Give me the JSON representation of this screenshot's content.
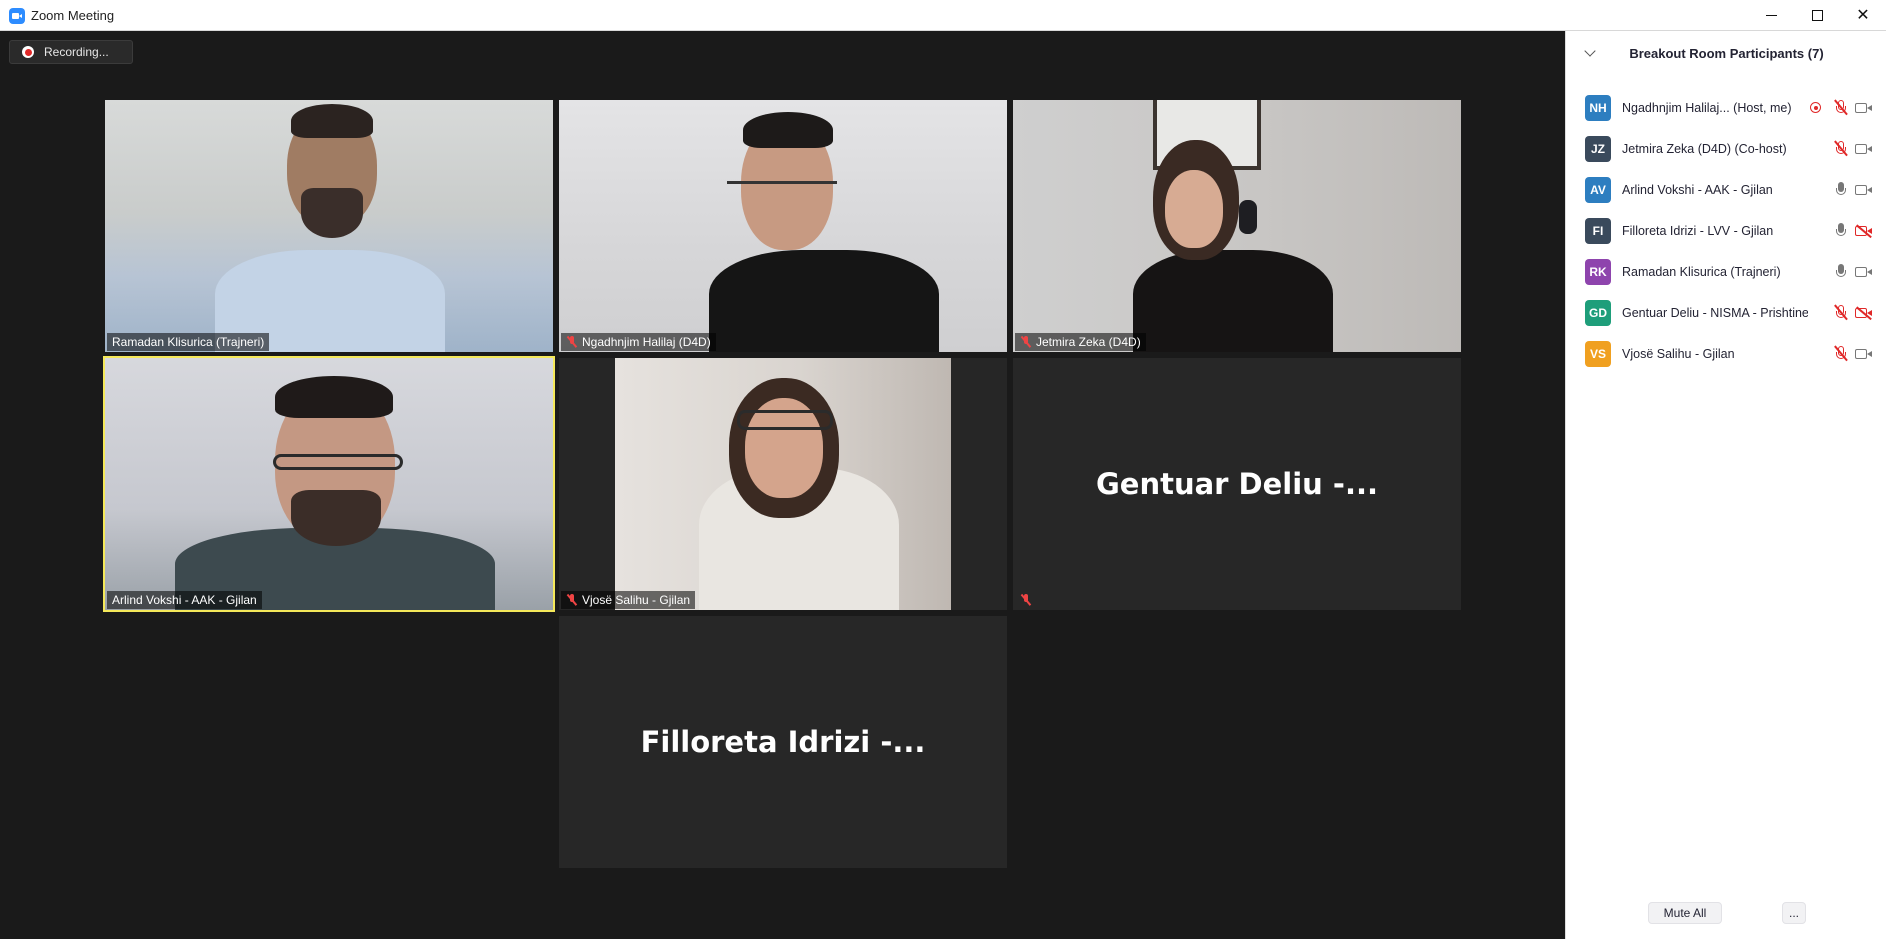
{
  "window": {
    "title": "Zoom Meeting"
  },
  "recording": {
    "label": "Recording..."
  },
  "tiles": [
    {
      "name": "Ramadan Klisurica (Trajneri)",
      "muted": false
    },
    {
      "name": "Ngadhnjim Halilaj (D4D)",
      "muted": true
    },
    {
      "name": "Jetmira Zeka (D4D)",
      "muted": true
    },
    {
      "name": "Arlind Vokshi - AAK - Gjilan",
      "muted": false,
      "active_speaker": true
    },
    {
      "name": "Vjosë Salihu - Gjilan",
      "muted": true
    },
    {
      "name": "",
      "muted": true,
      "display_name": "Gentuar Deliu -..."
    },
    {
      "name": "",
      "display_name": "Filloreta Idrizi -..."
    }
  ],
  "sidebar": {
    "title": "Breakout Room Participants (7)",
    "participants": [
      {
        "initials": "NH",
        "name": "Ngadhnjim Halilaj...  (Host, me)",
        "color": "#2d7ec0",
        "recording": true,
        "mic": "muted",
        "cam": "on"
      },
      {
        "initials": "JZ",
        "name": "Jetmira Zeka (D4D) (Co-host)",
        "color": "#3a4a5c",
        "recording": false,
        "mic": "muted",
        "cam": "on"
      },
      {
        "initials": "AV",
        "name": "Arlind Vokshi - AAK - Gjilan",
        "color": "#2d7ec0",
        "recording": false,
        "mic": "on",
        "cam": "on"
      },
      {
        "initials": "FI",
        "name": "Filloreta Idrizi - LVV - Gjilan",
        "color": "#3a4a5c",
        "recording": false,
        "mic": "on",
        "cam": "off"
      },
      {
        "initials": "RK",
        "name": "Ramadan Klisurica (Trajneri)",
        "color": "#8e44ad",
        "recording": false,
        "mic": "on",
        "cam": "on"
      },
      {
        "initials": "GD",
        "name": "Gentuar Deliu - NISMA - Prishtine",
        "color": "#1e9e7a",
        "recording": false,
        "mic": "muted",
        "cam": "off"
      },
      {
        "initials": "VS",
        "name": "Vjosë Salihu - Gjilan",
        "color": "#f0a020",
        "recording": false,
        "mic": "muted",
        "cam": "on"
      }
    ],
    "footer": {
      "mute_all": "Mute All",
      "more": "..."
    }
  }
}
